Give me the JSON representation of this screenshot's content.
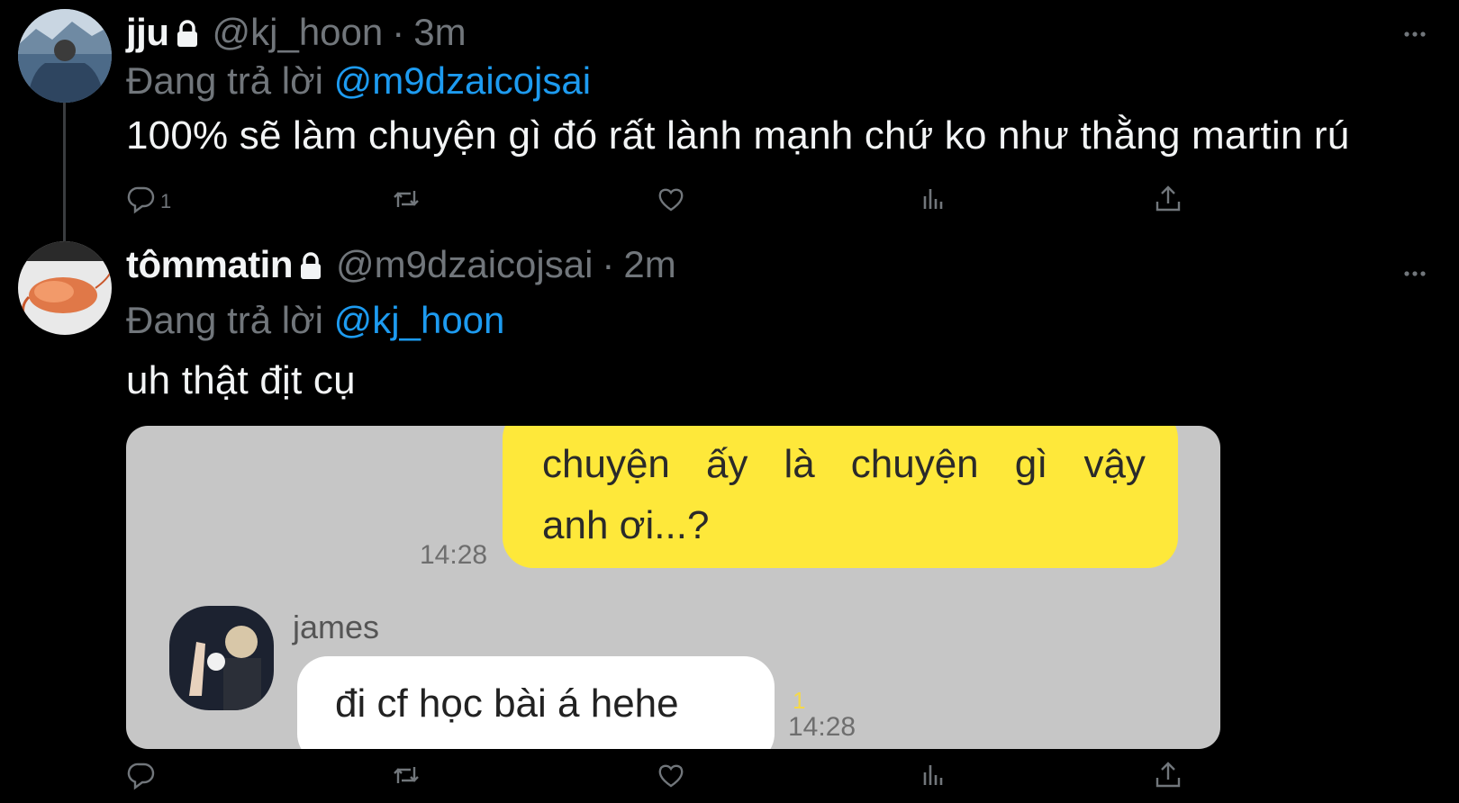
{
  "tweets": [
    {
      "display_name": "jju",
      "handle": "@kj_hoon",
      "separator": "·",
      "time": "3m",
      "reply_prefix": "Đang trả lời",
      "reply_mention": "@m9dzaicojsai",
      "text": "100% sẽ làm chuyện gì đó rất lành mạnh chứ ko như thằng martin rú",
      "reply_count": "1",
      "protected_icon": "lock-icon"
    },
    {
      "display_name": "tômmatin",
      "handle": "@m9dzaicojsai",
      "separator": "·",
      "time": "2m",
      "reply_prefix": "Đang trả lời",
      "reply_mention": "@kj_hoon",
      "text": "uh thật địt cụ",
      "reply_count": "",
      "protected_icon": "lock-icon"
    }
  ],
  "media_chat": {
    "sent_message_line1": [
      "chuyện",
      "ấy",
      "là",
      "chuyện",
      "gì",
      "vậy"
    ],
    "sent_message_line2": "anh ơi...?",
    "sent_time": "14:28",
    "friend_name": "james",
    "received_message": "đi cf học bài á hehe",
    "unread_count": "1",
    "received_time": "14:28"
  },
  "action_icons": [
    "reply-icon",
    "retweet-icon",
    "like-icon",
    "analytics-icon",
    "share-icon"
  ],
  "colors": {
    "background": "#000000",
    "mention": "#1d9bf0",
    "muted": "#71767b",
    "sent_bubble": "#fee83a",
    "chat_bg": "#c6c6c6"
  }
}
